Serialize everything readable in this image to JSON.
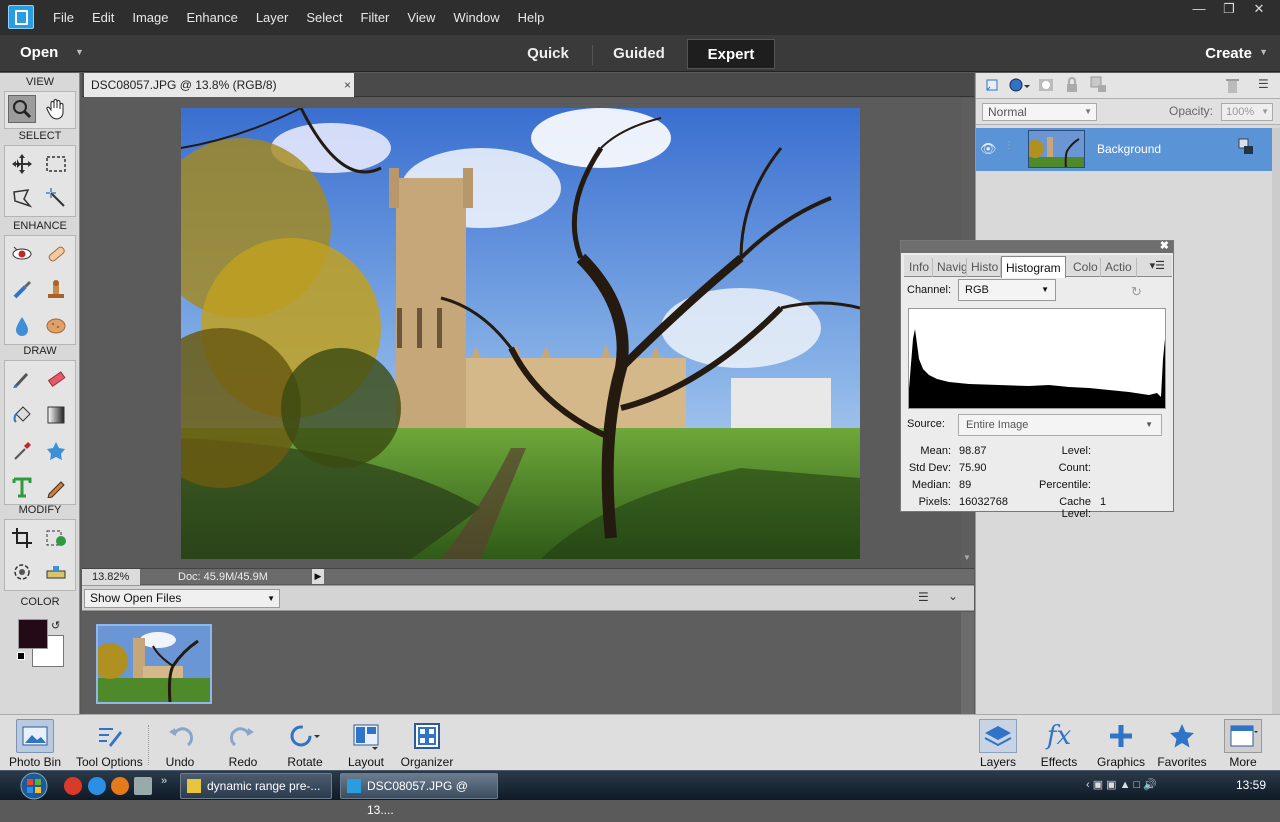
{
  "menubar": {
    "items": [
      "File",
      "Edit",
      "Image",
      "Enhance",
      "Layer",
      "Select",
      "Filter",
      "View",
      "Window",
      "Help"
    ]
  },
  "modebar": {
    "open_label": "Open",
    "tabs": [
      "Quick",
      "Guided",
      "Expert"
    ],
    "active_tab": "Expert",
    "create_label": "Create"
  },
  "toolbox": {
    "sections": [
      "VIEW",
      "SELECT",
      "ENHANCE",
      "DRAW",
      "MODIFY",
      "COLOR"
    ],
    "foreground_color": "#240916",
    "background_color": "#ffffff"
  },
  "document": {
    "tab_title": "DSC08057.JPG @ 13.8% (RGB/8)",
    "close_glyph": "×",
    "zoom": "13.82%",
    "doc_size": "Doc: 45.9M/45.9M"
  },
  "bin": {
    "select_value": "Show Open Files"
  },
  "layers": {
    "blend_mode": "Normal",
    "opacity_label": "Opacity:",
    "opacity_value": "100%",
    "layer_name": "Background",
    "layer_selected_color": "#5a93d6"
  },
  "histogram_panel": {
    "tabs": [
      "Info",
      "Navig",
      "Histo",
      "Histogram",
      "Colo",
      "Actio"
    ],
    "active_tab": "Histogram",
    "channel_label": "Channel:",
    "channel_value": "RGB",
    "source_label": "Source:",
    "source_value": "Entire Image",
    "stats": {
      "mean_label": "Mean:",
      "mean": "98.87",
      "stddev_label": "Std Dev:",
      "stddev": "75.90",
      "median_label": "Median:",
      "median": "89",
      "pixels_label": "Pixels:",
      "pixels": "16032768",
      "level_label": "Level:",
      "count_label": "Count:",
      "percentile_label": "Percentile:",
      "cache_label": "Cache Level:",
      "cache": "1"
    }
  },
  "bottombar": {
    "left": [
      "Photo Bin",
      "Tool Options",
      "Undo",
      "Redo",
      "Rotate",
      "Layout",
      "Organizer"
    ],
    "right": [
      "Layers",
      "Effects",
      "Graphics",
      "Favorites",
      "More"
    ]
  },
  "taskbar": {
    "tasks": [
      "dynamic range pre-...",
      "DSC08057.JPG @ 13...."
    ],
    "clock": "13:59"
  }
}
